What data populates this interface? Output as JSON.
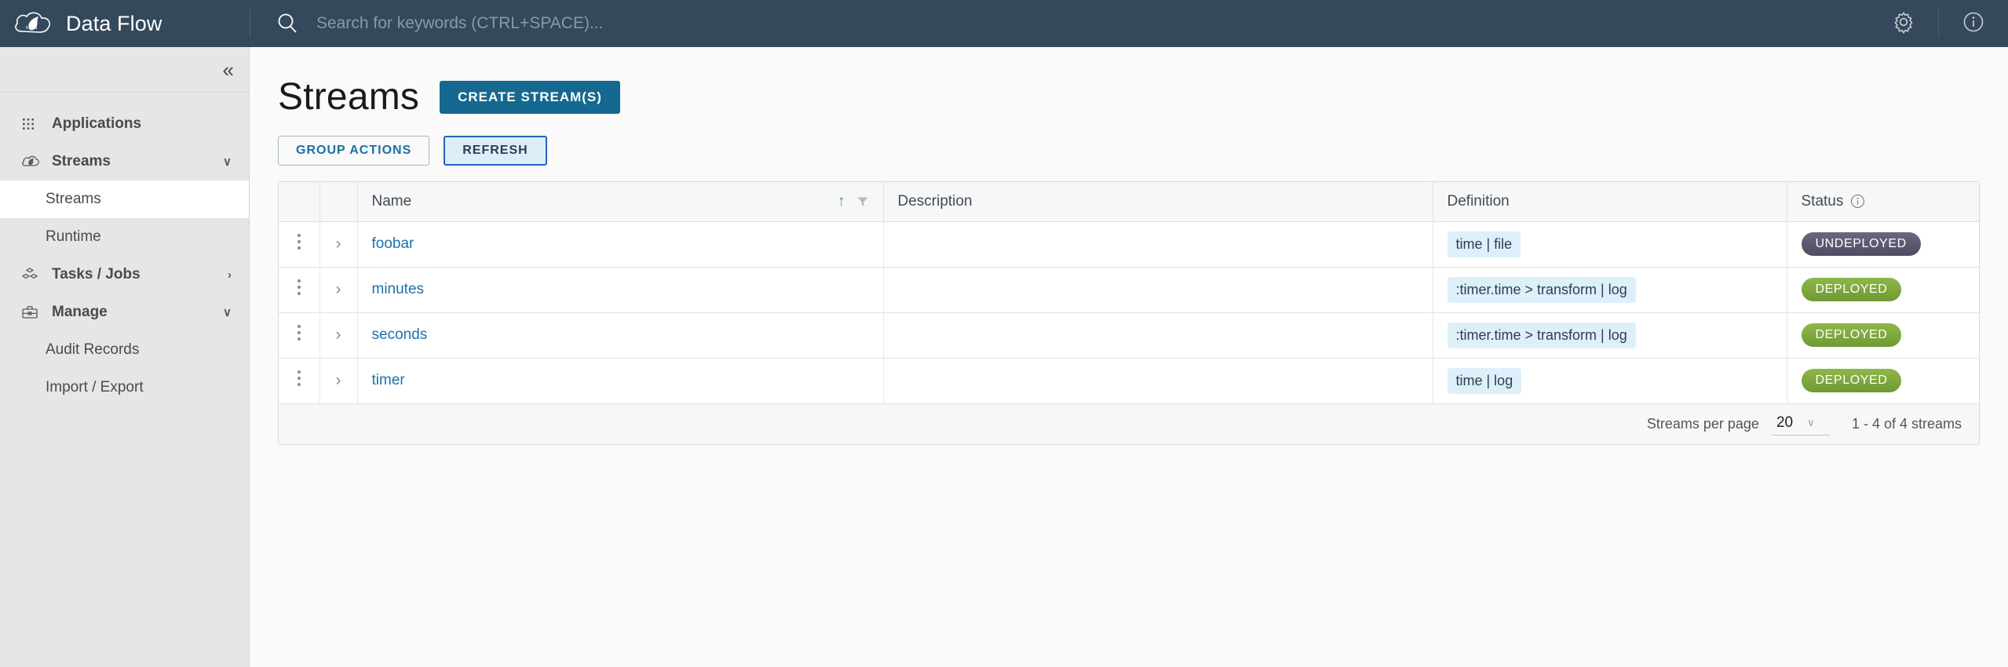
{
  "topbar": {
    "logo_icon": "spring-cloud-logo",
    "title": "Data Flow",
    "search": {
      "icon": "search-icon",
      "placeholder": "Search for keywords (CTRL+SPACE)...",
      "value": ""
    },
    "settings_icon": "gear-icon",
    "about_icon": "info-circle-icon"
  },
  "sidebar": {
    "collapse_glyph": "«",
    "items": [
      {
        "label": "Applications",
        "icon": "grid-apps-icon",
        "type": "group",
        "caret": "",
        "active": false
      },
      {
        "label": "Streams",
        "icon": "cloud-streams-icon",
        "type": "group",
        "caret": "∨",
        "active": false
      },
      {
        "label": "Streams",
        "icon": "",
        "type": "sub",
        "caret": "",
        "active": true
      },
      {
        "label": "Runtime",
        "icon": "",
        "type": "sub",
        "caret": "",
        "active": false
      },
      {
        "label": "Tasks / Jobs",
        "icon": "tasks-jobs-icon",
        "type": "group",
        "caret": "›",
        "active": false
      },
      {
        "label": "Manage",
        "icon": "briefcase-icon",
        "type": "group",
        "caret": "∨",
        "active": false
      },
      {
        "label": "Audit Records",
        "icon": "",
        "type": "sub",
        "caret": "",
        "active": false
      },
      {
        "label": "Import / Export",
        "icon": "",
        "type": "sub",
        "caret": "",
        "active": false
      }
    ]
  },
  "page": {
    "title": "Streams",
    "create_button": "CREATE STREAM(S)",
    "group_actions_button": "GROUP ACTIONS",
    "refresh_button": "REFRESH"
  },
  "table": {
    "columns": {
      "name": "Name",
      "description": "Description",
      "definition": "Definition",
      "status": "Status"
    },
    "name_sort_icon": "sort-ascending-icon",
    "name_filter_icon": "funnel-filter-icon",
    "status_info_icon": "info-circle-icon",
    "rows": [
      {
        "name": "foobar",
        "description": "",
        "definition": "time | file",
        "status": "UNDEPLOYED",
        "status_kind": "undeployed"
      },
      {
        "name": "minutes",
        "description": "",
        "definition": ":timer.time > transform | log",
        "status": "DEPLOYED",
        "status_kind": "deployed"
      },
      {
        "name": "seconds",
        "description": "",
        "definition": ":timer.time > transform | log",
        "status": "DEPLOYED",
        "status_kind": "deployed"
      },
      {
        "name": "timer",
        "description": "",
        "definition": "time | log",
        "status": "DEPLOYED",
        "status_kind": "deployed"
      }
    ]
  },
  "pagination": {
    "per_page_label": "Streams per page",
    "per_page_value": "20",
    "caret": "∨",
    "range_text": "1 - 4 of 4 streams"
  },
  "colors": {
    "topbar_bg": "#34495b",
    "primary": "#15688f",
    "link": "#1a72ad",
    "deployed": "#7aa93e",
    "undeployed": "#5d5673"
  }
}
